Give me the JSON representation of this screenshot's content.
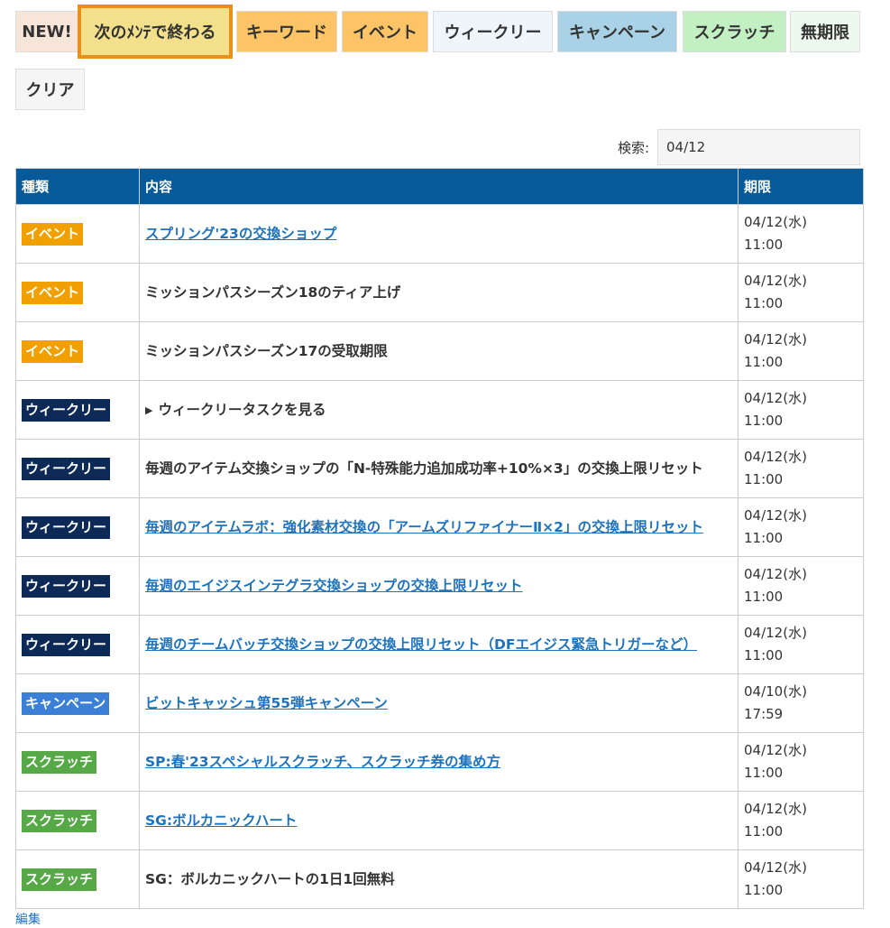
{
  "filters": [
    {
      "label": "NEW!",
      "bg": "#f7e5da",
      "active": false
    },
    {
      "label": "次のﾒﾝﾃで終わる",
      "bg": "#f3e08a",
      "active": true
    },
    {
      "label": "キーワード",
      "bg": "#fcc466",
      "active": false
    },
    {
      "label": "イベント",
      "bg": "#fcc466",
      "active": false
    },
    {
      "label": "ウィークリー",
      "bg": "#eef5fb",
      "active": false
    },
    {
      "label": "キャンペーン",
      "bg": "#aad2e6",
      "active": false
    },
    {
      "label": "スクラッチ",
      "bg": "#c3f0c3",
      "active": false
    },
    {
      "label": "無期限",
      "bg": "#edf8ee",
      "active": false
    },
    {
      "label": "クリア",
      "bg": "#f5f5f5",
      "active": false
    }
  ],
  "search": {
    "label": "検索:",
    "value": "04/12"
  },
  "table": {
    "headers": {
      "type": "種類",
      "content": "内容",
      "deadline": "期限"
    },
    "rows": [
      {
        "category": "イベント",
        "category_key": "event",
        "content": "スプリング'23の交換ショップ",
        "is_link": true,
        "has_toggle": false,
        "date": "04/12(水)",
        "time": "11:00"
      },
      {
        "category": "イベント",
        "category_key": "event",
        "content": "ミッションパスシーズン18のティア上げ",
        "is_link": false,
        "has_toggle": false,
        "date": "04/12(水)",
        "time": "11:00"
      },
      {
        "category": "イベント",
        "category_key": "event",
        "content": "ミッションパスシーズン17の受取期限",
        "is_link": false,
        "has_toggle": false,
        "date": "04/12(水)",
        "time": "11:00"
      },
      {
        "category": "ウィークリー",
        "category_key": "weekly",
        "content": "ウィークリータスクを見る",
        "is_link": false,
        "has_toggle": true,
        "date": "04/12(水)",
        "time": "11:00"
      },
      {
        "category": "ウィークリー",
        "category_key": "weekly",
        "content": "毎週のアイテム交換ショップの「N-特殊能力追加成功率+10%×3」の交換上限リセット",
        "is_link": false,
        "has_toggle": false,
        "date": "04/12(水)",
        "time": "11:00"
      },
      {
        "category": "ウィークリー",
        "category_key": "weekly",
        "content": "毎週のアイテムラボ：強化素材交換の「アームズリファイナーⅡ×2」の交換上限リセット",
        "is_link": true,
        "has_toggle": false,
        "date": "04/12(水)",
        "time": "11:00"
      },
      {
        "category": "ウィークリー",
        "category_key": "weekly",
        "content": "毎週のエイジスインテグラ交換ショップの交換上限リセット",
        "is_link": true,
        "has_toggle": false,
        "date": "04/12(水)",
        "time": "11:00"
      },
      {
        "category": "ウィークリー",
        "category_key": "weekly",
        "content": "毎週のチームバッチ交換ショップの交換上限リセット（DFエイジス緊急トリガーなど）",
        "is_link": true,
        "has_toggle": false,
        "date": "04/12(水)",
        "time": "11:00"
      },
      {
        "category": "キャンペーン",
        "category_key": "campaign",
        "content": "ビットキャッシュ第55弾キャンペーン",
        "is_link": true,
        "has_toggle": false,
        "date": "04/10(水)",
        "time": "17:59"
      },
      {
        "category": "スクラッチ",
        "category_key": "scratch",
        "content": "SP:春'23スペシャルスクラッチ、スクラッチ券の集め方",
        "is_link": true,
        "has_toggle": false,
        "date": "04/12(水)",
        "time": "11:00"
      },
      {
        "category": "スクラッチ",
        "category_key": "scratch",
        "content": "SG:ボルカニックハート",
        "is_link": true,
        "has_toggle": false,
        "date": "04/12(水)",
        "time": "11:00"
      },
      {
        "category": "スクラッチ",
        "category_key": "scratch",
        "content": "SG：ボルカニックハートの1日1回無料",
        "is_link": false,
        "has_toggle": false,
        "date": "04/12(水)",
        "time": "11:00"
      }
    ]
  },
  "footer": {
    "link_label": "編集"
  }
}
